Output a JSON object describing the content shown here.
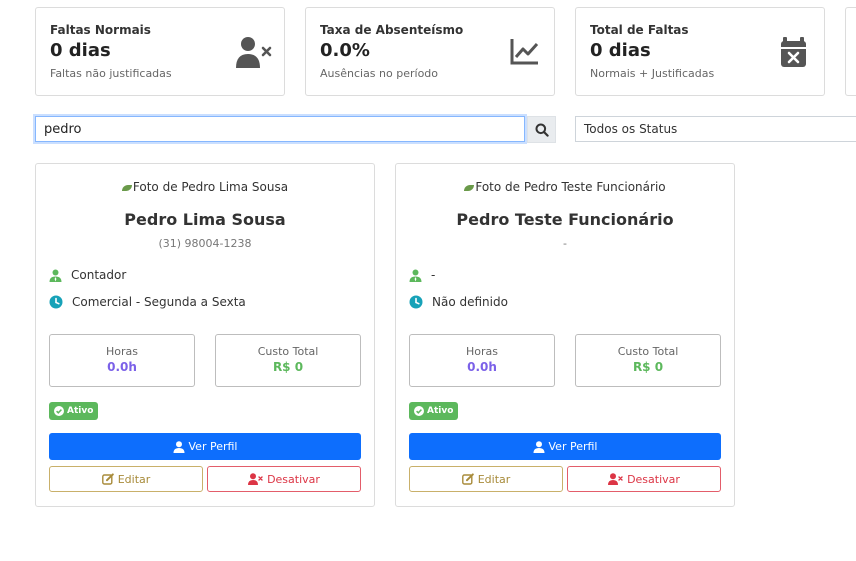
{
  "stats": [
    {
      "title": "Faltas Normais",
      "value": "0 dias",
      "sub": "Faltas não justificadas",
      "icon": "user-x-icon"
    },
    {
      "title": "Taxa de Absenteísmo",
      "value": "0.0%",
      "sub": "Ausências no período",
      "icon": "line-chart-icon"
    },
    {
      "title": "Total de Faltas",
      "value": "0 dias",
      "sub": "Normais + Justificadas",
      "icon": "calendar-x-icon"
    }
  ],
  "search": {
    "value": "pedro"
  },
  "status_filter": {
    "selected": "Todos os Status"
  },
  "employees": [
    {
      "photo_alt": "Foto de Pedro Lima Sousa",
      "name": "Pedro Lima Sousa",
      "phone": "(31) 98004-1238",
      "role": "Contador",
      "schedule": "Comercial - Segunda a Sexta",
      "hours_label": "Horas",
      "hours_value": "0.0h",
      "cost_label": "Custo Total",
      "cost_value": "R$ 0",
      "status": "Ativo",
      "profile_label": "Ver Perfil",
      "edit_label": "Editar",
      "deactivate_label": "Desativar"
    },
    {
      "photo_alt": "Foto de Pedro Teste Funcionário",
      "name": "Pedro Teste Funcionário",
      "phone": "-",
      "role": "-",
      "schedule": "Não definido",
      "hours_label": "Horas",
      "hours_value": "0.0h",
      "cost_label": "Custo Total",
      "cost_value": "R$ 0",
      "status": "Ativo",
      "profile_label": "Ver Perfil",
      "edit_label": "Editar",
      "deactivate_label": "Desativar"
    }
  ],
  "colors": {
    "primary": "#0d6efd",
    "hours": "#7b61e8",
    "cost": "#5cb85c",
    "success": "#5cb85c",
    "warning_outline": "#c9b06a",
    "danger": "#dc3545",
    "role_icon": "#5cb85c",
    "clock_icon": "#17a2b8",
    "stat_icon": "#555555"
  }
}
